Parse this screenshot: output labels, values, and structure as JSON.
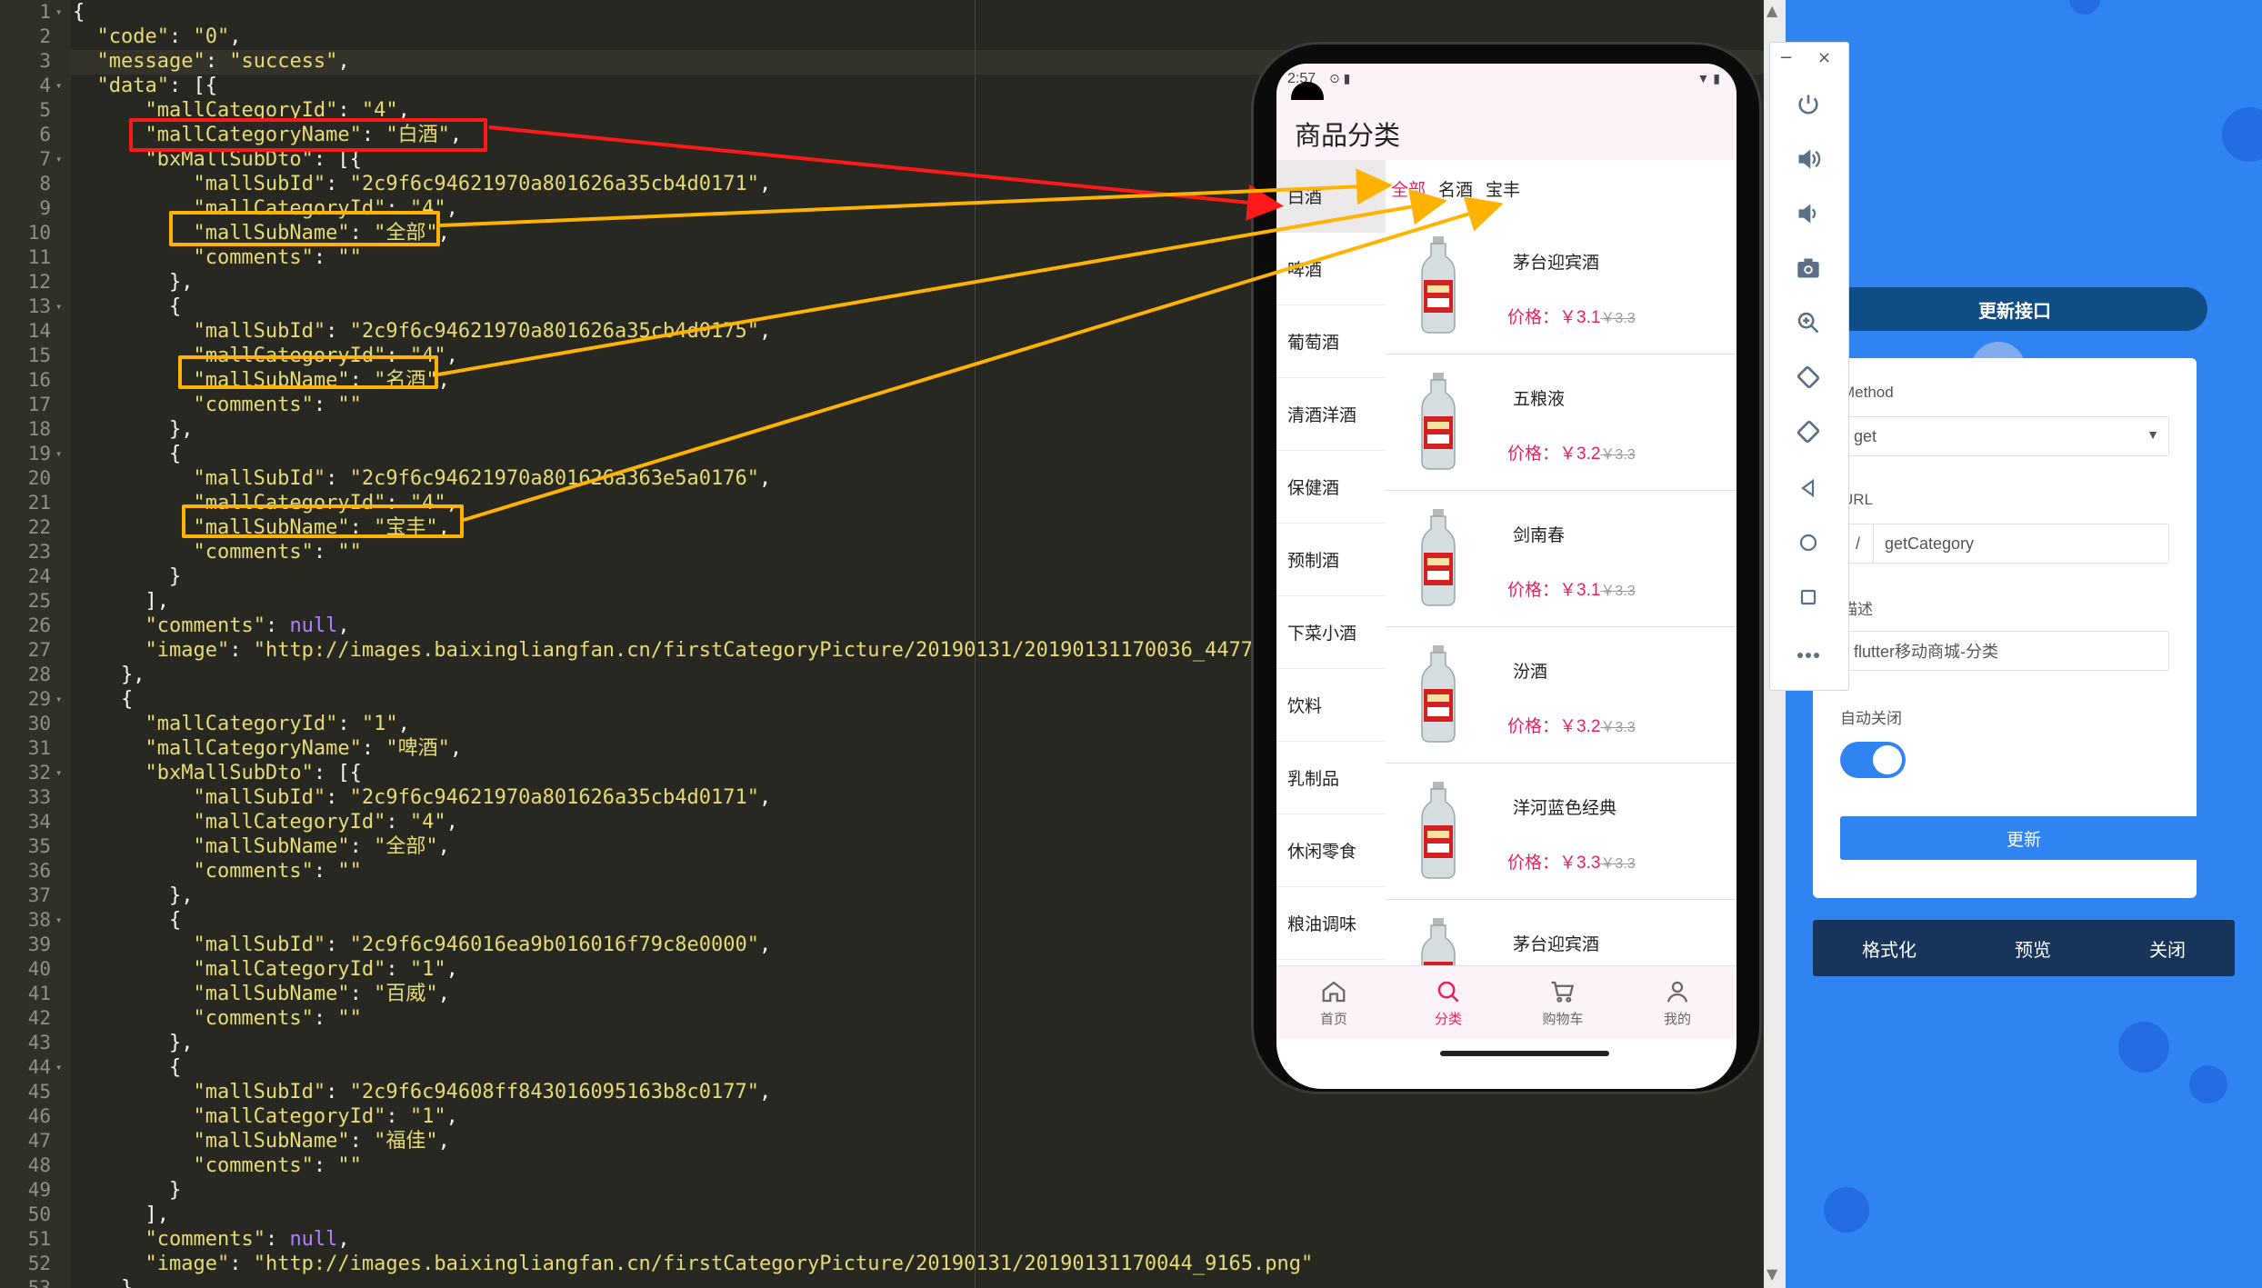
{
  "editor": {
    "lines": [
      {
        "num": "1",
        "fold": true,
        "text": "{"
      },
      {
        "num": "2",
        "fold": false,
        "text": "  \"code\": \"0\","
      },
      {
        "num": "3",
        "fold": false,
        "text": "  \"message\": \"success\","
      },
      {
        "num": "4",
        "fold": true,
        "text": "  \"data\": [{"
      },
      {
        "num": "5",
        "fold": false,
        "text": "      \"mallCategoryId\": \"4\","
      },
      {
        "num": "6",
        "fold": false,
        "text": "      \"mallCategoryName\": \"白酒\","
      },
      {
        "num": "7",
        "fold": true,
        "text": "      \"bxMallSubDto\": [{"
      },
      {
        "num": "8",
        "fold": false,
        "text": "          \"mallSubId\": \"2c9f6c94621970a801626a35cb4d0171\","
      },
      {
        "num": "9",
        "fold": false,
        "text": "          \"mallCategoryId\": \"4\","
      },
      {
        "num": "10",
        "fold": false,
        "text": "          \"mallSubName\": \"全部\","
      },
      {
        "num": "11",
        "fold": false,
        "text": "          \"comments\": \"\""
      },
      {
        "num": "12",
        "fold": false,
        "text": "        },"
      },
      {
        "num": "13",
        "fold": true,
        "text": "        {"
      },
      {
        "num": "14",
        "fold": false,
        "text": "          \"mallSubId\": \"2c9f6c94621970a801626a35cb4d0175\","
      },
      {
        "num": "15",
        "fold": false,
        "text": "          \"mallCategoryId\": \"4\","
      },
      {
        "num": "16",
        "fold": false,
        "text": "          \"mallSubName\": \"名酒\","
      },
      {
        "num": "17",
        "fold": false,
        "text": "          \"comments\": \"\""
      },
      {
        "num": "18",
        "fold": false,
        "text": "        },"
      },
      {
        "num": "19",
        "fold": true,
        "text": "        {"
      },
      {
        "num": "20",
        "fold": false,
        "text": "          \"mallSubId\": \"2c9f6c94621970a801626a363e5a0176\","
      },
      {
        "num": "21",
        "fold": false,
        "text": "          \"mallCategoryId\": \"4\","
      },
      {
        "num": "22",
        "fold": false,
        "text": "          \"mallSubName\": \"宝丰\","
      },
      {
        "num": "23",
        "fold": false,
        "text": "          \"comments\": \"\""
      },
      {
        "num": "24",
        "fold": false,
        "text": "        }"
      },
      {
        "num": "25",
        "fold": false,
        "text": "      ],"
      },
      {
        "num": "26",
        "fold": false,
        "text": "      \"comments\": null,"
      },
      {
        "num": "27",
        "fold": false,
        "text": "      \"image\": \"http://images.baixingliangfan.cn/firstCategoryPicture/20190131/20190131170036_4477.png\""
      },
      {
        "num": "28",
        "fold": false,
        "text": "    },"
      },
      {
        "num": "29",
        "fold": true,
        "text": "    {"
      },
      {
        "num": "30",
        "fold": false,
        "text": "      \"mallCategoryId\": \"1\","
      },
      {
        "num": "31",
        "fold": false,
        "text": "      \"mallCategoryName\": \"啤酒\","
      },
      {
        "num": "32",
        "fold": true,
        "text": "      \"bxMallSubDto\": [{"
      },
      {
        "num": "33",
        "fold": false,
        "text": "          \"mallSubId\": \"2c9f6c94621970a801626a35cb4d0171\","
      },
      {
        "num": "34",
        "fold": false,
        "text": "          \"mallCategoryId\": \"4\","
      },
      {
        "num": "35",
        "fold": false,
        "text": "          \"mallSubName\": \"全部\","
      },
      {
        "num": "36",
        "fold": false,
        "text": "          \"comments\": \"\""
      },
      {
        "num": "37",
        "fold": false,
        "text": "        },"
      },
      {
        "num": "38",
        "fold": true,
        "text": "        {"
      },
      {
        "num": "39",
        "fold": false,
        "text": "          \"mallSubId\": \"2c9f6c946016ea9b016016f79c8e0000\","
      },
      {
        "num": "40",
        "fold": false,
        "text": "          \"mallCategoryId\": \"1\","
      },
      {
        "num": "41",
        "fold": false,
        "text": "          \"mallSubName\": \"百威\","
      },
      {
        "num": "42",
        "fold": false,
        "text": "          \"comments\": \"\""
      },
      {
        "num": "43",
        "fold": false,
        "text": "        },"
      },
      {
        "num": "44",
        "fold": true,
        "text": "        {"
      },
      {
        "num": "45",
        "fold": false,
        "text": "          \"mallSubId\": \"2c9f6c94608ff843016095163b8c0177\","
      },
      {
        "num": "46",
        "fold": false,
        "text": "          \"mallCategoryId\": \"1\","
      },
      {
        "num": "47",
        "fold": false,
        "text": "          \"mallSubName\": \"福佳\","
      },
      {
        "num": "48",
        "fold": false,
        "text": "          \"comments\": \"\""
      },
      {
        "num": "49",
        "fold": false,
        "text": "        }"
      },
      {
        "num": "50",
        "fold": false,
        "text": "      ],"
      },
      {
        "num": "51",
        "fold": false,
        "text": "      \"comments\": null,"
      },
      {
        "num": "52",
        "fold": false,
        "text": "      \"image\": \"http://images.baixingliangfan.cn/firstCategoryPicture/20190131/20190131170044_9165.png\""
      },
      {
        "num": "53",
        "fold": false,
        "text": "    },"
      }
    ]
  },
  "colors": {
    "editor_bg": "#272822",
    "json_string": "#e6db74",
    "json_null": "#ae81ff",
    "highlight_red": "#ff1a1a",
    "highlight_yellow": "#ffb300",
    "panel_blue": "#2f84f2",
    "accent_pink": "#e91e63"
  },
  "toolbar": {
    "minimize": "−",
    "close": "×",
    "buttons": [
      "power-icon",
      "volume-up-icon",
      "volume-down-icon",
      "camera-icon",
      "zoom-icon",
      "rotate-left-icon",
      "rotate-right-icon",
      "back-icon",
      "home-icon",
      "overview-icon",
      "more-icon"
    ]
  },
  "phone": {
    "status_time": "2:57",
    "title": "商品分类",
    "categories": [
      "白酒",
      "啤酒",
      "葡萄酒",
      "清酒洋酒",
      "保健酒",
      "预制酒",
      "下菜小酒",
      "饮料",
      "乳制品",
      "休闲零食",
      "粮油调味"
    ],
    "active_category": "白酒",
    "subtabs": [
      "全部",
      "名酒",
      "宝丰"
    ],
    "active_subtab": "全部",
    "products": [
      {
        "name": "茅台迎宾酒",
        "price": "价格：￥3.1",
        "old": "￥3.3"
      },
      {
        "name": "五粮液",
        "price": "价格：￥3.2",
        "old": "￥3.3"
      },
      {
        "name": "剑南春",
        "price": "价格：￥3.1",
        "old": "￥3.3"
      },
      {
        "name": "汾酒",
        "price": "价格：￥3.2",
        "old": "￥3.3"
      },
      {
        "name": "洋河蓝色经典",
        "price": "价格：￥3.3",
        "old": "￥3.3"
      },
      {
        "name": "茅台迎宾酒",
        "price": "",
        "old": ""
      }
    ],
    "bottom_nav": [
      {
        "label": "首页",
        "icon": "home-icon"
      },
      {
        "label": "分类",
        "icon": "search-icon"
      },
      {
        "label": "购物车",
        "icon": "cart-icon"
      },
      {
        "label": "我的",
        "icon": "user-icon"
      }
    ],
    "active_nav": "分类"
  },
  "panel": {
    "tab_title": "更新接口",
    "method_label": "Method",
    "method_value": "get",
    "url_label": "URL",
    "url_prefix": "/",
    "url_value": "getCategory",
    "desc_label": "描述",
    "desc_value": "flutter移动商城-分类",
    "auto_close_label": "自动关闭",
    "auto_close_on": true,
    "update_button": "更新",
    "bottom_buttons": [
      "格式化",
      "预览",
      "关闭"
    ]
  }
}
